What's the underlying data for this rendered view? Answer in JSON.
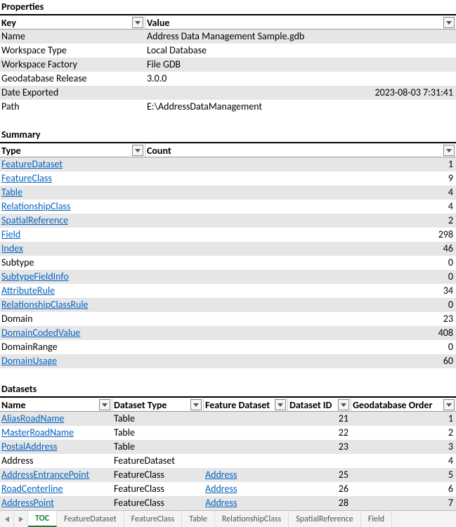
{
  "sections": {
    "properties_title": "Properties",
    "summary_title": "Summary",
    "datasets_title": "Datasets"
  },
  "properties": {
    "headers": {
      "key": "Key",
      "value": "Value"
    },
    "rows": [
      {
        "key": "Name",
        "value": "Address Data Management Sample.gdb",
        "shade": true
      },
      {
        "key": "Workspace Type",
        "value": "Local Database",
        "shade": false
      },
      {
        "key": "Workspace Factory",
        "value": "File GDB",
        "shade": true
      },
      {
        "key": "Geodatabase Release",
        "value": "3.0.0",
        "shade": false
      },
      {
        "key": "Date Exported",
        "value": "2023-08-03 7:31:41",
        "shade": true,
        "value_right": true
      },
      {
        "key": "Path",
        "value": "E:\\AddressDataManagement",
        "shade": false
      }
    ]
  },
  "summary": {
    "headers": {
      "type": "Type",
      "count": "Count"
    },
    "rows": [
      {
        "type": "FeatureDataset",
        "count": "1",
        "link": true,
        "shade": true
      },
      {
        "type": "FeatureClass",
        "count": "9",
        "link": true,
        "shade": false
      },
      {
        "type": "Table",
        "count": "4",
        "link": true,
        "shade": true
      },
      {
        "type": "RelationshipClass",
        "count": "4",
        "link": true,
        "shade": false
      },
      {
        "type": "SpatialReference",
        "count": "2",
        "link": true,
        "shade": true
      },
      {
        "type": "Field",
        "count": "298",
        "link": true,
        "shade": false
      },
      {
        "type": "Index",
        "count": "46",
        "link": true,
        "shade": true
      },
      {
        "type": "Subtype",
        "count": "0",
        "link": false,
        "shade": false
      },
      {
        "type": "SubtypeFieldInfo",
        "count": "0",
        "link": true,
        "shade": true
      },
      {
        "type": "AttributeRule",
        "count": "34",
        "link": true,
        "shade": false
      },
      {
        "type": "RelationshipClassRule",
        "count": "0",
        "link": true,
        "shade": true
      },
      {
        "type": "Domain",
        "count": "23",
        "link": false,
        "shade": false
      },
      {
        "type": "DomainCodedValue",
        "count": "408",
        "link": true,
        "shade": true
      },
      {
        "type": "DomainRange",
        "count": "0",
        "link": false,
        "shade": false
      },
      {
        "type": "DomainUsage",
        "count": "60",
        "link": true,
        "shade": true
      }
    ]
  },
  "datasets": {
    "headers": {
      "name": "Name",
      "type": "Dataset Type",
      "fd": "Feature Dataset",
      "id": "Dataset ID",
      "order": "Geodatabase Order"
    },
    "rows": [
      {
        "name": "AliasRoadName",
        "name_link": true,
        "type": "Table",
        "fd": "",
        "fd_link": false,
        "id": "21",
        "order": "1",
        "shade": true
      },
      {
        "name": "MasterRoadName",
        "name_link": true,
        "type": "Table",
        "fd": "",
        "fd_link": false,
        "id": "22",
        "order": "2",
        "shade": false
      },
      {
        "name": "PostalAddress",
        "name_link": true,
        "type": "Table",
        "fd": "",
        "fd_link": false,
        "id": "23",
        "order": "3",
        "shade": true
      },
      {
        "name": "Address",
        "name_link": false,
        "type": "FeatureDataset",
        "fd": "",
        "fd_link": false,
        "id": "",
        "order": "4",
        "shade": false
      },
      {
        "name": "AddressEntrancePoint",
        "name_link": true,
        "type": "FeatureClass",
        "fd": "Address",
        "fd_link": true,
        "id": "25",
        "order": "5",
        "shade": true
      },
      {
        "name": "RoadCenterline",
        "name_link": true,
        "type": "FeatureClass",
        "fd": "Address",
        "fd_link": true,
        "id": "26",
        "order": "6",
        "shade": false
      },
      {
        "name": "AddressPoint",
        "name_link": true,
        "type": "FeatureClass",
        "fd": "Address",
        "fd_link": true,
        "id": "28",
        "order": "7",
        "shade": true
      }
    ]
  },
  "tabs": {
    "items": [
      "TOC",
      "FeatureDataset",
      "FeatureClass",
      "Table",
      "RelationshipClass",
      "SpatialReference",
      "Field"
    ],
    "active": "TOC"
  }
}
